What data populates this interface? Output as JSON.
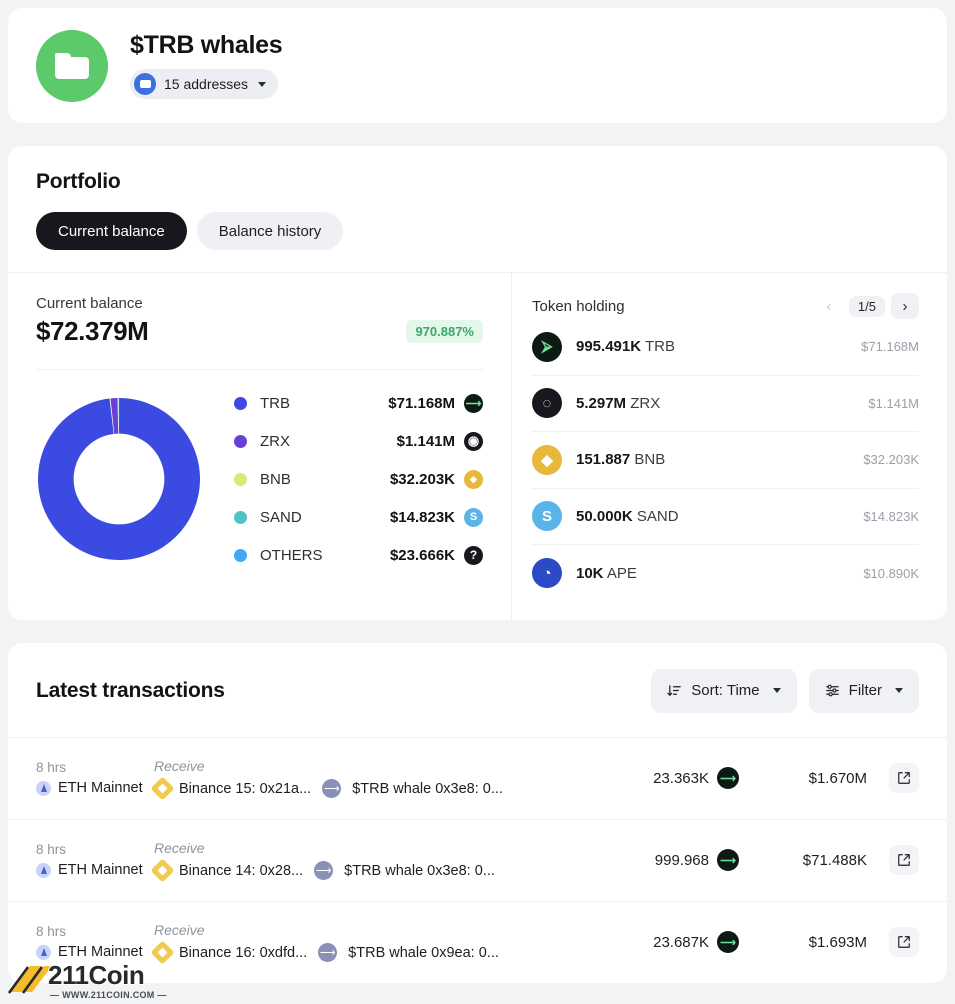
{
  "header": {
    "folder_icon": "folder-icon",
    "title": "$TRB whales",
    "address_badge": {
      "icon": "wallet-icon",
      "label": "15 addresses",
      "caret": "chevron-down-icon"
    }
  },
  "portfolio": {
    "title": "Portfolio",
    "tabs": [
      {
        "label": "Current balance",
        "active": true
      },
      {
        "label": "Balance history",
        "active": false
      }
    ],
    "balance": {
      "label": "Current balance",
      "amount": "$72.379M",
      "change": "970.887%",
      "change_color": "#3aa869",
      "change_bg": "#e3f7ea"
    },
    "legend": [
      {
        "name": "TRB",
        "value": "$71.168M",
        "color": "#3b4ae0",
        "coin_bg": "#0d1a14",
        "coin_glyph": "⮚"
      },
      {
        "name": "ZRX",
        "value": "$1.141M",
        "color": "#6b3fd4",
        "coin_bg": "#16181d",
        "coin_glyph": "◌"
      },
      {
        "name": "BNB",
        "value": "$32.203K",
        "color": "#dde878",
        "coin_bg": "#e8b83c",
        "coin_glyph": "◆"
      },
      {
        "name": "SAND",
        "value": "$14.823K",
        "color": "#4fc4c0",
        "coin_bg": "#5ab4e8",
        "coin_glyph": "S"
      },
      {
        "name": "OTHERS",
        "value": "$23.666K",
        "color": "#3fa9f5",
        "coin_bg": "#16181d",
        "coin_glyph": "?"
      }
    ]
  },
  "chart_data": {
    "type": "pie",
    "title": "Current balance breakdown",
    "subtitle": "",
    "labels": [
      "TRB",
      "ZRX",
      "BNB",
      "SAND",
      "OTHERS"
    ],
    "values": [
      71168000,
      1141000,
      32203,
      14823,
      23666
    ],
    "value_labels": [
      "$71.168M",
      "$1.141M",
      "$32.203K",
      "$14.823K",
      "$23.666K"
    ],
    "percentages": [
      98.33,
      1.576,
      0.0445,
      0.0205,
      0.0327
    ],
    "colors": [
      "#3b4ae0",
      "#6b3fd4",
      "#dde878",
      "#4fc4c0",
      "#3fa9f5"
    ],
    "donut": true,
    "inner_radius_ratio": 0.56,
    "legend_position": "right",
    "total": "$72.379M",
    "grid": false
  },
  "token_holding": {
    "title": "Token holding",
    "pager": {
      "prev": "‹",
      "count": "1/5",
      "next": "›",
      "prev_disabled": true
    },
    "rows": [
      {
        "amount": "995.491K",
        "symbol": "TRB",
        "usd": "$71.168M",
        "coin_bg": "#0d1a14",
        "coin_fg": "#6fe39a",
        "glyph": "⮚"
      },
      {
        "amount": "5.297M",
        "symbol": "ZRX",
        "usd": "$1.141M",
        "coin_bg": "#16181d",
        "coin_fg": "#ffffff",
        "glyph": "◌"
      },
      {
        "amount": "151.887",
        "symbol": "BNB",
        "usd": "$32.203K",
        "coin_bg": "#e8b83c",
        "coin_fg": "#ffffff",
        "glyph": "◆"
      },
      {
        "amount": "50.000K",
        "symbol": "SAND",
        "usd": "$14.823K",
        "coin_bg": "#5ab4e8",
        "coin_fg": "#ffffff",
        "glyph": "S"
      },
      {
        "amount": "10K",
        "symbol": "APE",
        "usd": "$10.890K",
        "coin_bg": "#2a4bc4",
        "coin_fg": "#ffffff",
        "glyph": "◔"
      }
    ]
  },
  "transactions": {
    "title": "Latest transactions",
    "sort_button": {
      "icon": "sort-icon",
      "label": "Sort: Time",
      "caret": "chevron-down-icon"
    },
    "filter_button": {
      "icon": "filter-icon",
      "label": "Filter",
      "caret": "chevron-down-icon"
    },
    "rows": [
      {
        "time": "8 hrs",
        "chain": "ETH Mainnet",
        "type": "Receive",
        "from": "Binance 15: 0x21a...",
        "to": "$TRB whale 0x3e8: 0...",
        "amount": "23.363K",
        "token_glyph": "⮚",
        "usd": "$1.670M",
        "link_icon": "external-link-icon"
      },
      {
        "time": "8 hrs",
        "chain": "ETH Mainnet",
        "type": "Receive",
        "from": "Binance 14: 0x28...",
        "to": "$TRB whale 0x3e8: 0...",
        "amount": "999.968",
        "token_glyph": "⮚",
        "usd": "$71.488K",
        "link_icon": "external-link-icon"
      },
      {
        "time": "8 hrs",
        "chain": "ETH Mainnet",
        "type": "Receive",
        "from": "Binance 16: 0xdfd...",
        "to": "$TRB whale 0x9ea: 0...",
        "amount": "23.687K",
        "token_glyph": "⮚",
        "usd": "$1.693M",
        "link_icon": "external-link-icon"
      }
    ]
  },
  "watermark": {
    "title": "211Coin",
    "subtitle": "— WWW.211COIN.COM —"
  }
}
